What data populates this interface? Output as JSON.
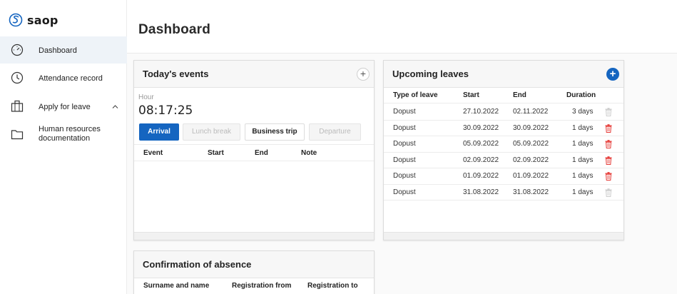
{
  "app": {
    "logo_text": "saop"
  },
  "sidebar": {
    "items": [
      {
        "label": "Dashboard",
        "icon": "speedometer-icon",
        "active": true
      },
      {
        "label": "Attendance record",
        "icon": "clock-icon",
        "active": false
      },
      {
        "label": "Apply for leave",
        "icon": "briefcase-icon",
        "active": false
      },
      {
        "label": "Human resources documentation",
        "icon": "folder-icon",
        "active": false
      }
    ]
  },
  "header": {
    "title": "Dashboard"
  },
  "todays_events": {
    "title": "Today's events",
    "hour_label": "Hour",
    "time": "08:17:25",
    "buttons": {
      "arrival": "Arrival",
      "lunch_break": "Lunch break",
      "business_trip": "Business trip",
      "departure": "Departure"
    },
    "columns": [
      "Event",
      "Start",
      "End",
      "Note"
    ]
  },
  "upcoming_leaves": {
    "title": "Upcoming leaves",
    "columns": [
      "Type of leave",
      "Start",
      "End",
      "Duration"
    ],
    "rows": [
      {
        "type": "Dopust",
        "start": "27.10.2022",
        "end": "02.11.2022",
        "duration": "3 days",
        "deletable": false
      },
      {
        "type": "Dopust",
        "start": "30.09.2022",
        "end": "30.09.2022",
        "duration": "1 days",
        "deletable": true
      },
      {
        "type": "Dopust",
        "start": "05.09.2022",
        "end": "05.09.2022",
        "duration": "1 days",
        "deletable": true
      },
      {
        "type": "Dopust",
        "start": "02.09.2022",
        "end": "02.09.2022",
        "duration": "1 days",
        "deletable": true
      },
      {
        "type": "Dopust",
        "start": "01.09.2022",
        "end": "01.09.2022",
        "duration": "1 days",
        "deletable": true
      },
      {
        "type": "Dopust",
        "start": "31.08.2022",
        "end": "31.08.2022",
        "duration": "1 days",
        "deletable": false
      }
    ]
  },
  "confirmation_of_absence": {
    "title": "Confirmation of absence",
    "columns": [
      "Surname and name",
      "Registration from",
      "Registration to"
    ]
  },
  "colors": {
    "accent": "#1565c0",
    "delete_active": "#e53935",
    "delete_disabled": "#cccccc",
    "active_nav_bg": "#eef3f8"
  }
}
